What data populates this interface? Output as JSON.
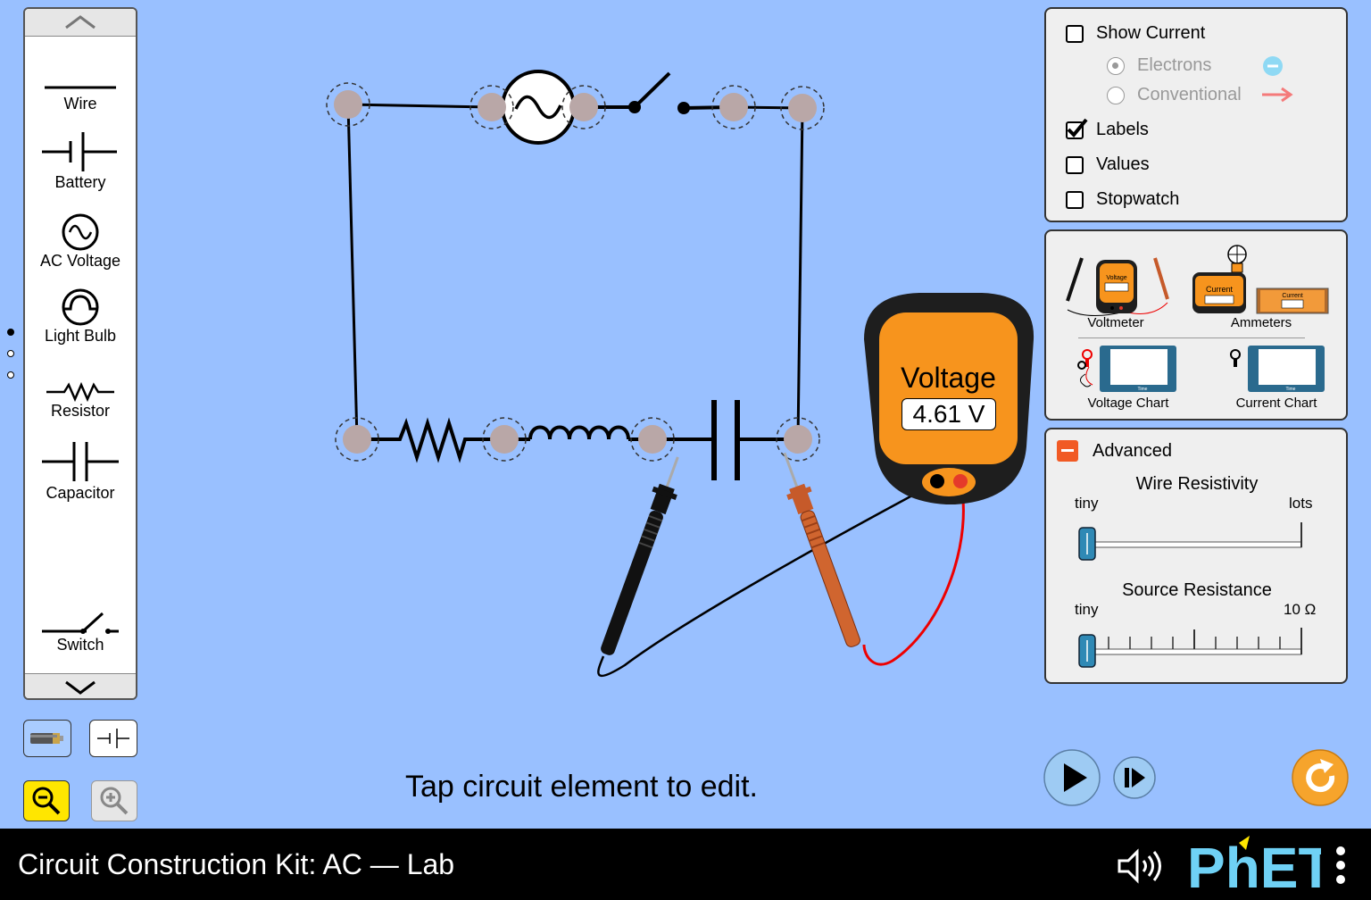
{
  "carousel": {
    "items": [
      {
        "label": "Wire",
        "icon": "wire-icon"
      },
      {
        "label": "Battery",
        "icon": "battery-icon"
      },
      {
        "label": "AC Voltage",
        "icon": "ac-voltage-icon"
      },
      {
        "label": "Light Bulb",
        "icon": "light-bulb-icon"
      },
      {
        "label": "Resistor",
        "icon": "resistor-icon"
      },
      {
        "label": "Capacitor",
        "icon": "capacitor-icon"
      },
      {
        "label": "Switch",
        "icon": "switch-icon"
      }
    ],
    "page_count": 3,
    "current_page": 1
  },
  "display_panel": {
    "show_current": {
      "label": "Show Current",
      "checked": false
    },
    "electrons": {
      "label": "Electrons",
      "selected": true
    },
    "conventional": {
      "label": "Conventional",
      "selected": false
    },
    "labels": {
      "label": "Labels",
      "checked": true
    },
    "values": {
      "label": "Values",
      "checked": false
    },
    "stopwatch": {
      "label": "Stopwatch",
      "checked": false
    }
  },
  "tools_panel": {
    "voltmeter": "Voltmeter",
    "ammeters": "Ammeters",
    "voltage_chart": "Voltage Chart",
    "current_chart": "Current Chart",
    "voltmeter_icon_text": "Voltage",
    "ammeter_icon_text": "Current",
    "chart_axis_time": "Time"
  },
  "advanced_panel": {
    "title": "Advanced",
    "expanded": true,
    "wire_resistivity": {
      "label": "Wire Resistivity",
      "min_label": "tiny",
      "max_label": "lots",
      "value_fraction": 0
    },
    "source_resistance": {
      "label": "Source Resistance",
      "min_label": "tiny",
      "max_label": "10 Ω",
      "value_fraction": 0
    }
  },
  "voltmeter": {
    "title": "Voltage",
    "reading": "4.61 V"
  },
  "hint": "Tap circuit element to edit.",
  "footer": {
    "title": "Circuit Construction Kit: AC — Lab",
    "brand": "PhET"
  },
  "colors": {
    "background": "#99c0ff",
    "meter_orange": "#f7941d",
    "play_blue": "#9ecbf3",
    "reset_orange": "#f6a42c"
  }
}
